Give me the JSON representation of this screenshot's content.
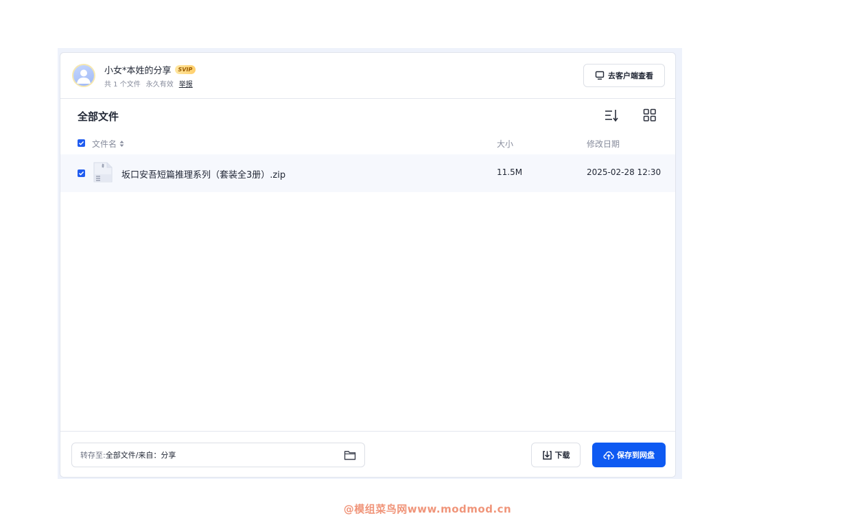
{
  "share": {
    "sharer_name": "小女*本姓的分享",
    "badge": "SVIP",
    "file_count": "共 1 个文件",
    "validity": "永久有效",
    "report_link": "举报",
    "client_button": "去客户端查看"
  },
  "toolbar": {
    "title": "全部文件",
    "sort_icon": "sort-list-icon",
    "grid_icon": "grid-view-icon"
  },
  "table": {
    "columns": {
      "name": "文件名",
      "size": "大小",
      "date": "修改日期"
    },
    "rows": [
      {
        "name": "坂口安吾短篇推理系列（套装全3册）.zip",
        "size": "11.5M",
        "date": "2025-02-28 12:30",
        "icon": "zip-file-icon",
        "checked": true
      }
    ]
  },
  "footer": {
    "path_label": "转存至:",
    "path_value": "全部文件/来自：分享",
    "download_button": "下载",
    "save_button": "保存到网盘"
  },
  "colors": {
    "accent": "#0e5af2",
    "checkbox": "#1f5bf0",
    "watermark": "#f0957a"
  },
  "watermark": "@模组菜鸟网www.modmod.cn"
}
